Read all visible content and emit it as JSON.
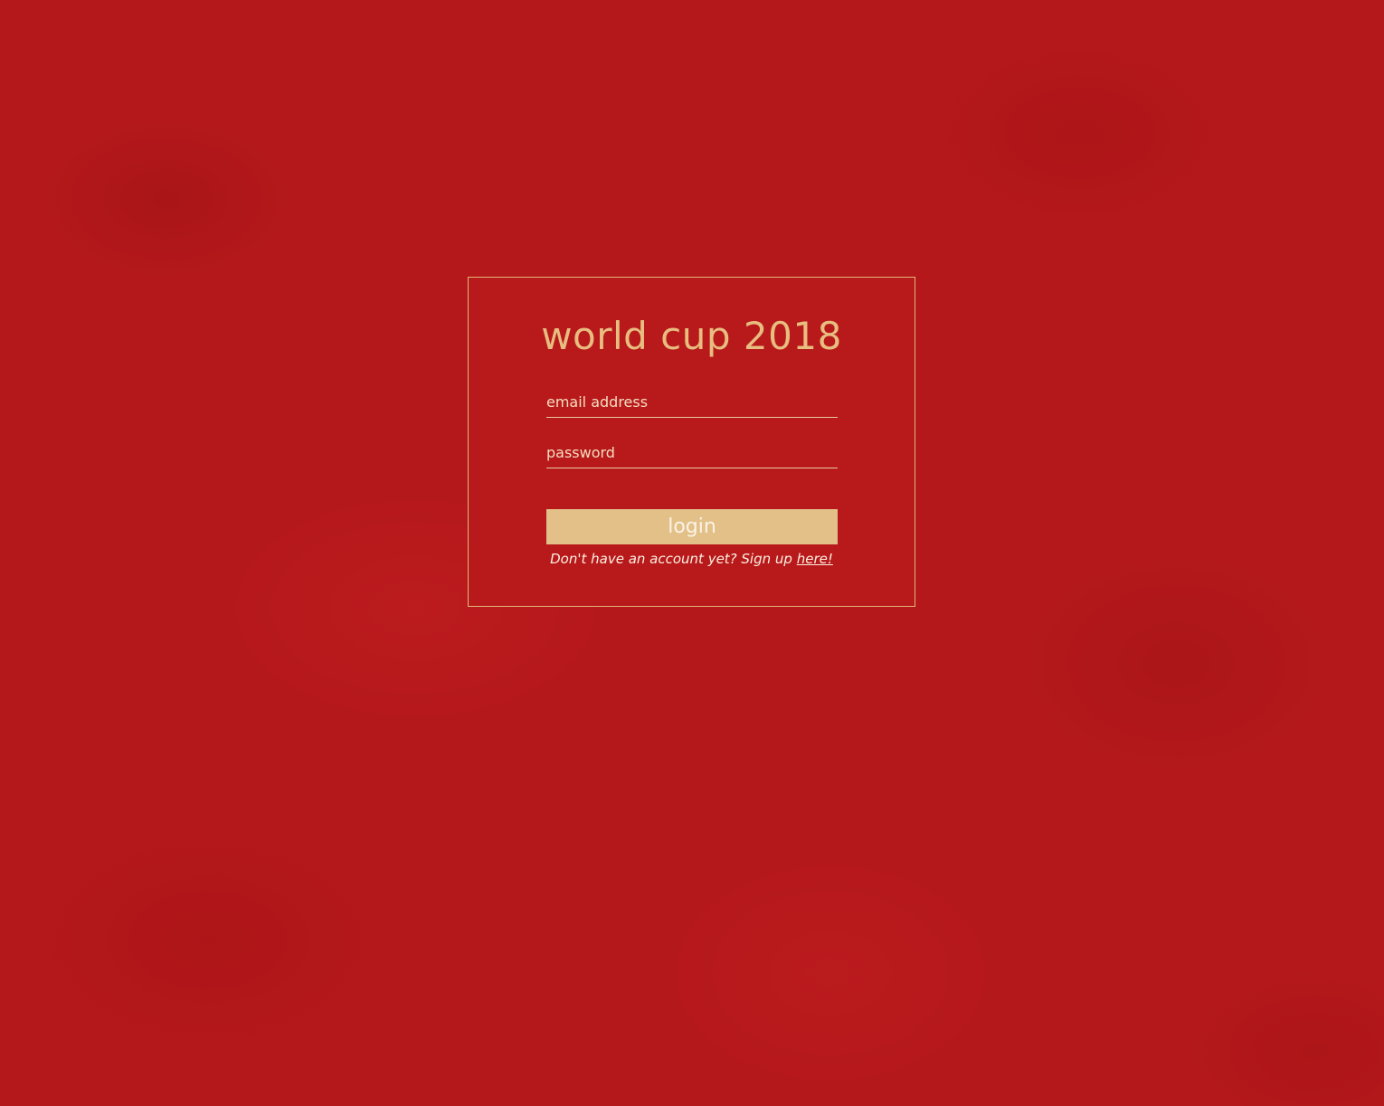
{
  "login_card": {
    "title": "world cup 2018",
    "email": {
      "placeholder": "email address",
      "value": ""
    },
    "password": {
      "placeholder": "password",
      "value": ""
    },
    "login_label": "login",
    "signup_prompt": "Don't have an account yet? Sign up ",
    "signup_link": "here!"
  },
  "colors": {
    "background": "#b5181b",
    "accent_gold": "#e2c088",
    "border_gold": "#e2b978",
    "text_light": "#fbf1e2"
  }
}
